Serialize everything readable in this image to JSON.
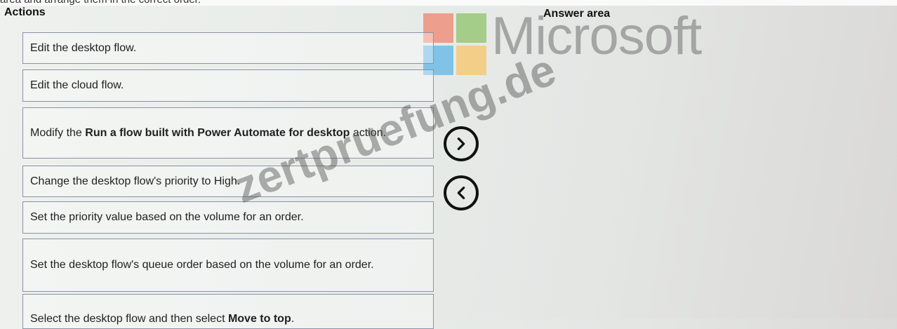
{
  "top_text": "area and arrange them in the correct order.",
  "actions_heading": "Actions",
  "answer_heading": "Answer area",
  "brand": {
    "logo_colors": [
      "#f0846e",
      "#8cc36a",
      "#5fb5e6",
      "#f6c46a"
    ],
    "wordmark": "Microsoft"
  },
  "actions": [
    {
      "pre": "Edit the desktop flow.",
      "bold": "",
      "post": ""
    },
    {
      "pre": "Edit the cloud flow.",
      "bold": "",
      "post": ""
    },
    {
      "pre": "Modify the ",
      "bold": "Run a flow built with Power Automate for desktop",
      "post": " action."
    },
    {
      "pre": "Change the desktop flow's priority to High.",
      "bold": "",
      "post": ""
    },
    {
      "pre": "Set the priority value based on the volume for an order.",
      "bold": "",
      "post": ""
    },
    {
      "pre": "Set the desktop flow's queue order based on the volume for an order.",
      "bold": "",
      "post": ""
    },
    {
      "pre": "Select the desktop flow and then select ",
      "bold": "Move to top",
      "post": "."
    }
  ],
  "controls": {
    "move_right_icon": "chevron-right-icon",
    "move_left_icon": "chevron-left-icon"
  },
  "watermark": "zertpruefung.de"
}
